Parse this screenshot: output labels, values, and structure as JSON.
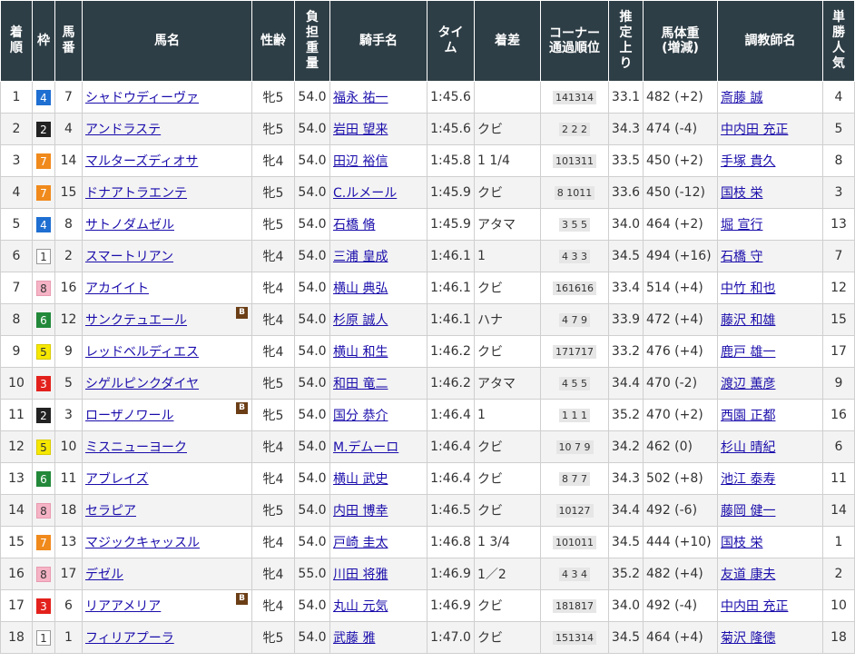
{
  "headers": {
    "rank": "着順",
    "waku": "枠",
    "umaban": "馬番",
    "horse": "馬名",
    "sexage": "性齢",
    "weight": "負担重量",
    "jockey": "騎手名",
    "time": "タイム",
    "margin": "着差",
    "corner_1": "コーナー",
    "corner_2": "通過順位",
    "last3f": "推定上り",
    "body_1": "馬体重",
    "body_2": "(増減)",
    "trainer": "調教師名",
    "pop": "単勝人気"
  },
  "blinker_label": "B",
  "waku_colors": {
    "1": "#ffffff",
    "2": "#222222",
    "3": "#e3211c",
    "4": "#1e6fd1",
    "5": "#f6e700",
    "6": "#22883a",
    "7": "#f08a1c",
    "8": "#f6b3c6"
  },
  "rows": [
    {
      "rank": "1",
      "waku": "4",
      "umaban": "7",
      "horse": "シャドウディーヴァ",
      "blinker": false,
      "sexage": "牝5",
      "weight": "54.0",
      "jockey": "福永 祐一",
      "time": "1:45.6",
      "margin": "",
      "corner": "141314",
      "last3f": "33.1",
      "body": "482 (+2)",
      "trainer": "斎藤 誠",
      "pop": "4"
    },
    {
      "rank": "2",
      "waku": "2",
      "umaban": "4",
      "horse": "アンドラステ",
      "blinker": false,
      "sexage": "牝5",
      "weight": "54.0",
      "jockey": "岩田 望来",
      "time": "1:45.6",
      "margin": "クビ",
      "corner": "2 2 2",
      "last3f": "34.3",
      "body": "474 (-4)",
      "trainer": "中内田 充正",
      "pop": "5"
    },
    {
      "rank": "3",
      "waku": "7",
      "umaban": "14",
      "horse": "マルターズディオサ",
      "blinker": false,
      "sexage": "牝4",
      "weight": "54.0",
      "jockey": "田辺 裕信",
      "time": "1:45.8",
      "margin": "1 1/4",
      "corner": "101311",
      "last3f": "33.5",
      "body": "450 (+2)",
      "trainer": "手塚 貴久",
      "pop": "8"
    },
    {
      "rank": "4",
      "waku": "7",
      "umaban": "15",
      "horse": "ドナアトラエンテ",
      "blinker": false,
      "sexage": "牝5",
      "weight": "54.0",
      "jockey": "C.ルメール",
      "time": "1:45.9",
      "margin": "クビ",
      "corner": "8 1011",
      "last3f": "33.6",
      "body": "450 (-12)",
      "trainer": "国枝 栄",
      "pop": "3"
    },
    {
      "rank": "5",
      "waku": "4",
      "umaban": "8",
      "horse": "サトノダムゼル",
      "blinker": false,
      "sexage": "牝5",
      "weight": "54.0",
      "jockey": "石橋 脩",
      "time": "1:45.9",
      "margin": "アタマ",
      "corner": "3 5 5",
      "last3f": "34.0",
      "body": "464 (+2)",
      "trainer": "堀 宣行",
      "pop": "13"
    },
    {
      "rank": "6",
      "waku": "1",
      "umaban": "2",
      "horse": "スマートリアン",
      "blinker": false,
      "sexage": "牝4",
      "weight": "54.0",
      "jockey": "三浦 皇成",
      "time": "1:46.1",
      "margin": "1",
      "corner": "4 3 3",
      "last3f": "34.5",
      "body": "494 (+16)",
      "trainer": "石橋 守",
      "pop": "7"
    },
    {
      "rank": "7",
      "waku": "8",
      "umaban": "16",
      "horse": "アカイイト",
      "blinker": false,
      "sexage": "牝4",
      "weight": "54.0",
      "jockey": "横山 典弘",
      "time": "1:46.1",
      "margin": "クビ",
      "corner": "161616",
      "last3f": "33.4",
      "body": "514 (+4)",
      "trainer": "中竹 和也",
      "pop": "12"
    },
    {
      "rank": "8",
      "waku": "6",
      "umaban": "12",
      "horse": "サンクテュエール",
      "blinker": true,
      "sexage": "牝4",
      "weight": "54.0",
      "jockey": "杉原 誠人",
      "time": "1:46.1",
      "margin": "ハナ",
      "corner": "4 7 9",
      "last3f": "33.9",
      "body": "472 (+4)",
      "trainer": "藤沢 和雄",
      "pop": "15"
    },
    {
      "rank": "9",
      "waku": "5",
      "umaban": "9",
      "horse": "レッドベルディエス",
      "blinker": false,
      "sexage": "牝4",
      "weight": "54.0",
      "jockey": "横山 和生",
      "time": "1:46.2",
      "margin": "クビ",
      "corner": "171717",
      "last3f": "33.2",
      "body": "476 (+4)",
      "trainer": "鹿戸 雄一",
      "pop": "17"
    },
    {
      "rank": "10",
      "waku": "3",
      "umaban": "5",
      "horse": "シゲルピンクダイヤ",
      "blinker": false,
      "sexage": "牝5",
      "weight": "54.0",
      "jockey": "和田 竜二",
      "time": "1:46.2",
      "margin": "アタマ",
      "corner": "4 5 5",
      "last3f": "34.4",
      "body": "470 (-2)",
      "trainer": "渡辺 薫彦",
      "pop": "9"
    },
    {
      "rank": "11",
      "waku": "2",
      "umaban": "3",
      "horse": "ローザノワール",
      "blinker": true,
      "sexage": "牝5",
      "weight": "54.0",
      "jockey": "国分 恭介",
      "time": "1:46.4",
      "margin": "1",
      "corner": "1 1 1",
      "last3f": "35.2",
      "body": "470 (+2)",
      "trainer": "西園 正都",
      "pop": "16"
    },
    {
      "rank": "12",
      "waku": "5",
      "umaban": "10",
      "horse": "ミスニューヨーク",
      "blinker": false,
      "sexage": "牝4",
      "weight": "54.0",
      "jockey": "M.デムーロ",
      "time": "1:46.4",
      "margin": "クビ",
      "corner": "10 7 9",
      "last3f": "34.2",
      "body": "462 (0)",
      "trainer": "杉山 晴紀",
      "pop": "6"
    },
    {
      "rank": "13",
      "waku": "6",
      "umaban": "11",
      "horse": "アブレイズ",
      "blinker": false,
      "sexage": "牝4",
      "weight": "54.0",
      "jockey": "横山 武史",
      "time": "1:46.4",
      "margin": "クビ",
      "corner": "8 7 7",
      "last3f": "34.3",
      "body": "502 (+8)",
      "trainer": "池江 泰寿",
      "pop": "11"
    },
    {
      "rank": "14",
      "waku": "8",
      "umaban": "18",
      "horse": "セラピア",
      "blinker": false,
      "sexage": "牝5",
      "weight": "54.0",
      "jockey": "内田 博幸",
      "time": "1:46.5",
      "margin": "クビ",
      "corner": "10127",
      "last3f": "34.4",
      "body": "492 (-6)",
      "trainer": "藤岡 健一",
      "pop": "14"
    },
    {
      "rank": "15",
      "waku": "7",
      "umaban": "13",
      "horse": "マジックキャッスル",
      "blinker": false,
      "sexage": "牝4",
      "weight": "54.0",
      "jockey": "戸崎 圭太",
      "time": "1:46.8",
      "margin": "1 3/4",
      "corner": "101011",
      "last3f": "34.5",
      "body": "444 (+10)",
      "trainer": "国枝 栄",
      "pop": "1"
    },
    {
      "rank": "16",
      "waku": "8",
      "umaban": "17",
      "horse": "デゼル",
      "blinker": false,
      "sexage": "牝4",
      "weight": "55.0",
      "jockey": "川田 将雅",
      "time": "1:46.9",
      "margin": "1／2",
      "corner": "4 3 4",
      "last3f": "35.2",
      "body": "482 (+4)",
      "trainer": "友道 康夫",
      "pop": "2"
    },
    {
      "rank": "17",
      "waku": "3",
      "umaban": "6",
      "horse": "リアアメリア",
      "blinker": true,
      "sexage": "牝4",
      "weight": "54.0",
      "jockey": "丸山 元気",
      "time": "1:46.9",
      "margin": "クビ",
      "corner": "181817",
      "last3f": "34.0",
      "body": "492 (-4)",
      "trainer": "中内田 充正",
      "pop": "10"
    },
    {
      "rank": "18",
      "waku": "1",
      "umaban": "1",
      "horse": "フィリアプーラ",
      "blinker": false,
      "sexage": "牝5",
      "weight": "54.0",
      "jockey": "武藤 雅",
      "time": "1:47.0",
      "margin": "クビ",
      "corner": "151314",
      "last3f": "34.5",
      "body": "464 (+4)",
      "trainer": "菊沢 隆徳",
      "pop": "18"
    }
  ]
}
